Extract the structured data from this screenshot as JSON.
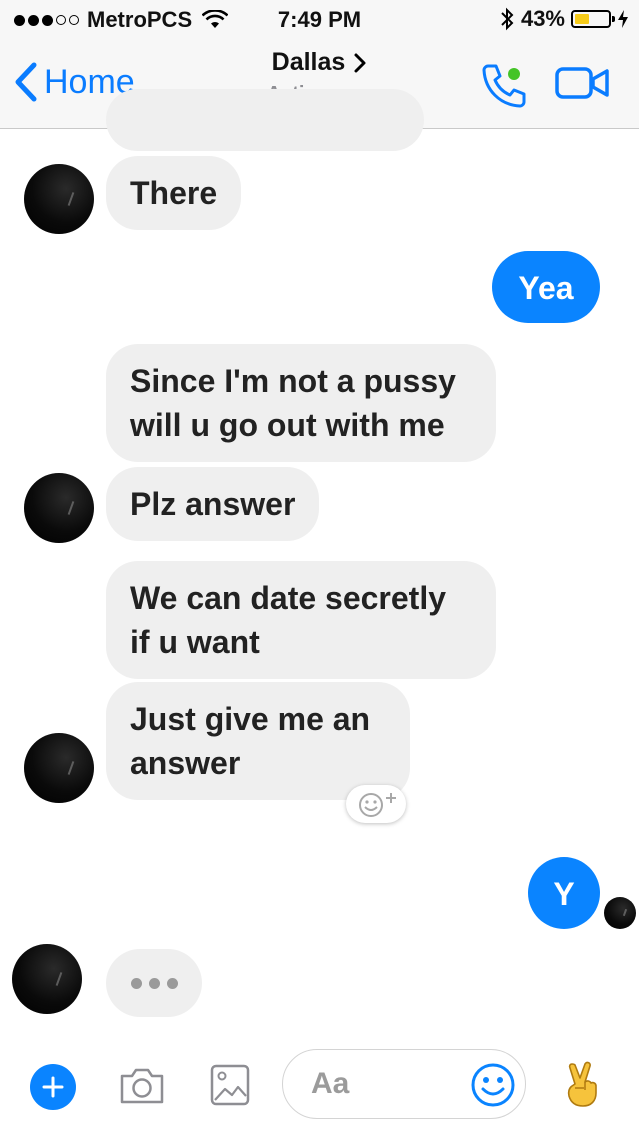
{
  "status_bar": {
    "carrier": "MetroPCS",
    "time": "7:49 PM",
    "battery": "43%",
    "battery_level": 0.43,
    "battery_color": "#f7cc1a"
  },
  "header": {
    "back_label": "Home",
    "contact_name": "Dallas",
    "presence": "Active now",
    "accent": "#0a7cff",
    "presence_dot_color": "#44c427"
  },
  "messages": [
    {
      "from": "them",
      "text": "There"
    },
    {
      "from": "me",
      "text": "Yea"
    },
    {
      "from": "them",
      "text": "Since I'm not a pussy\nwill u go out with me"
    },
    {
      "from": "them",
      "text": "Plz answer"
    },
    {
      "from": "them",
      "text": "We can date secretly\nif u want"
    },
    {
      "from": "them",
      "text": "Just give me an\nanswer"
    },
    {
      "from": "me",
      "text": "Y"
    }
  ],
  "composer": {
    "placeholder": "Aa",
    "icons": [
      "plus-icon",
      "camera-icon",
      "image-icon",
      "emoji-icon",
      "victory-hand-icon"
    ]
  },
  "colors": {
    "outgoing_bubble": "#0a84ff",
    "incoming_bubble": "#efefef"
  }
}
